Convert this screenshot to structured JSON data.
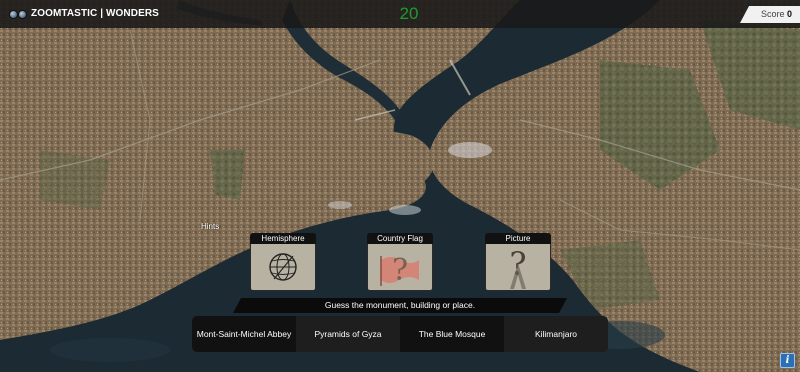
{
  "app": {
    "title": "ZOOMTASTIC | WONDERS"
  },
  "timer": {
    "value": "20"
  },
  "score": {
    "label": "Score",
    "value": "0"
  },
  "hints": {
    "label": "Hints",
    "cards": [
      {
        "title": "Hemisphere",
        "icon": "globe-icon"
      },
      {
        "title": "Country Flag",
        "icon": "flag-question-icon"
      },
      {
        "title": "Picture",
        "icon": "tower-question-icon"
      }
    ]
  },
  "question": {
    "text": "Guess the monument, building or place."
  },
  "answers": [
    "Mont-Saint-Michel Abbey",
    "Pyramids of Gyza",
    "The Blue Mosque",
    "Kilimanjaro"
  ],
  "info": {
    "label": "i"
  },
  "colors": {
    "timer": "#1f9a2f",
    "info_button": "#2d6fb5",
    "water": "#1b2a33"
  }
}
